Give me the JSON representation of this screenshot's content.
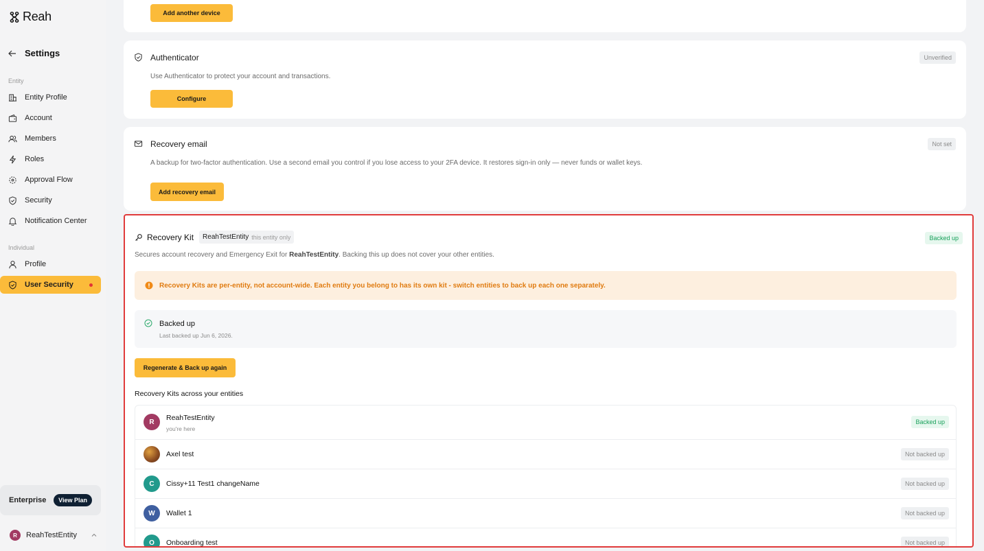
{
  "app": {
    "logo_text": "Reah"
  },
  "sidebar": {
    "title": "Settings",
    "entity_section": "Entity",
    "individual_section": "Individual",
    "entity_items": [
      {
        "label": "Entity Profile",
        "icon": "building-icon"
      },
      {
        "label": "Account",
        "icon": "wallet-icon"
      },
      {
        "label": "Members",
        "icon": "members-icon"
      },
      {
        "label": "Roles",
        "icon": "bolt-icon"
      },
      {
        "label": "Approval Flow",
        "icon": "flow-icon"
      },
      {
        "label": "Security",
        "icon": "shield-icon"
      },
      {
        "label": "Notification Center",
        "icon": "bell-icon"
      }
    ],
    "individual_items": [
      {
        "label": "Profile",
        "icon": "person-icon"
      },
      {
        "label": "User Security",
        "icon": "shield-icon",
        "active": true,
        "has_alert": true
      }
    ],
    "plan": {
      "name": "Enterprise",
      "button": "View Plan"
    },
    "current_entity": {
      "initial": "R",
      "name": "ReahTestEntity"
    }
  },
  "device_card": {
    "button": "Add another device"
  },
  "authenticator": {
    "title": "Authenticator",
    "status": "Unverified",
    "description": "Use Authenticator to protect your account and transactions.",
    "button": "Configure"
  },
  "recovery_email": {
    "title": "Recovery email",
    "status": "Not set",
    "description": "A backup for two-factor authentication. Use a second email you control if you lose access to your 2FA device. It restores sign-in only — never funds or wallet keys.",
    "button": "Add recovery email"
  },
  "recovery_kit": {
    "title": "Recovery Kit",
    "entity_name": "ReahTestEntity",
    "entity_note": "this entity only",
    "status": "Backed up",
    "description_prefix": "Secures account recovery and Emergency Exit for ",
    "description_entity": "ReahTestEntity",
    "description_suffix": ". Backing this up does not cover your other entities.",
    "warning": "Recovery Kits are per-entity, not account-wide. Each entity you belong to has its own kit - switch entities to back up each one separately.",
    "backup_status_title": "Backed up",
    "backup_status_sub": "Last backed up Jun 6, 2026.",
    "button": "Regenerate & Back up again",
    "list_heading": "Recovery Kits across your entities",
    "entities": [
      {
        "initial": "R",
        "name": "ReahTestEntity",
        "sub": "you're here",
        "status": "Backed up",
        "backed_up": true,
        "color": "#a23a62"
      },
      {
        "initial": "",
        "name": "Axel test",
        "sub": "",
        "status": "Not backed up",
        "backed_up": false,
        "color": "#b86b2a"
      },
      {
        "initial": "C",
        "name": "Cissy+11 Test1 changeName",
        "sub": "",
        "status": "Not backed up",
        "backed_up": false,
        "color": "#219a8c"
      },
      {
        "initial": "W",
        "name": "Wallet 1",
        "sub": "",
        "status": "Not backed up",
        "backed_up": false,
        "color": "#3f5fa0"
      },
      {
        "initial": "O",
        "name": "Onboarding test",
        "sub": "",
        "status": "Not backed up",
        "backed_up": false,
        "color": "#219a8c"
      }
    ]
  }
}
